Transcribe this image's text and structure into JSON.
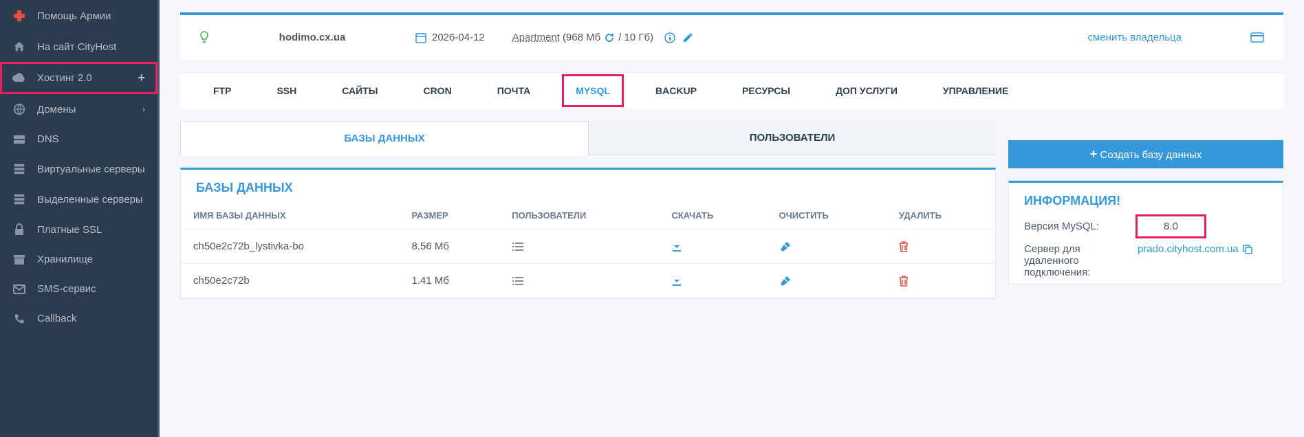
{
  "sidebar": {
    "items": [
      {
        "label": "Помощь Армии"
      },
      {
        "label": "На сайт CityHost"
      },
      {
        "label": "Хостинг 2.0"
      },
      {
        "label": "Домены"
      },
      {
        "label": "DNS"
      },
      {
        "label": "Виртуальные серверы"
      },
      {
        "label": "Выделенные серверы"
      },
      {
        "label": "Платные SSL"
      },
      {
        "label": "Хранилище"
      },
      {
        "label": "SMS-сервис"
      },
      {
        "label": "Callback"
      }
    ]
  },
  "header": {
    "domain": "hodimo.cx.ua",
    "date": "2026-04-12",
    "tariff_name": "Apartment",
    "used": "(968 Мб",
    "total": "/ 10 Гб)",
    "change_owner": "сменить владельца"
  },
  "tabs": {
    "items": [
      {
        "label": "FTP"
      },
      {
        "label": "SSH"
      },
      {
        "label": "САЙТЫ"
      },
      {
        "label": "CRON"
      },
      {
        "label": "ПОЧТА"
      },
      {
        "label": "MYSQL"
      },
      {
        "label": "BACKUP"
      },
      {
        "label": "РЕСУРСЫ"
      },
      {
        "label": "ДОП УСЛУГИ"
      },
      {
        "label": "УПРАВЛЕНИЕ"
      }
    ]
  },
  "subtabs": {
    "databases": "БАЗЫ ДАННЫХ",
    "users": "ПОЛЬЗОВАТЕЛИ"
  },
  "buttons": {
    "create_db": "Создать базу данных"
  },
  "panel_left": {
    "title": "БАЗЫ ДАННЫХ",
    "columns": {
      "name": "ИМЯ БАЗЫ ДАННЫХ",
      "size": "РАЗМЕР",
      "users": "ПОЛЬЗОВАТЕЛИ",
      "download": "СКАЧАТЬ",
      "clear": "ОЧИСТИТЬ",
      "delete": "УДАЛИТЬ"
    },
    "rows": [
      {
        "name": "ch50e2c72b_lystivka-bo",
        "size": "8.56 Мб"
      },
      {
        "name": "ch50e2c72b",
        "size": "1.41 Мб"
      }
    ]
  },
  "panel_right": {
    "title": "ИНФОРМАЦИЯ!",
    "version_label": "Версия MySQL:",
    "version_value": "8.0",
    "server_label": "Сервер для удаленного подключения:",
    "server_value": "prado.cityhost.com.ua"
  }
}
